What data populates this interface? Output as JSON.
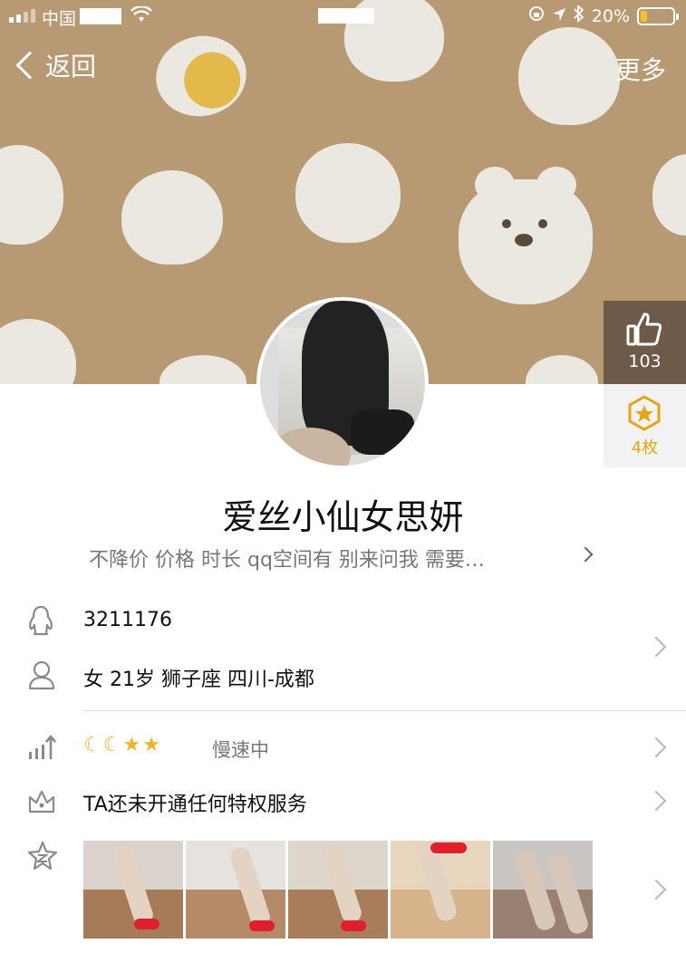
{
  "status_bar": {
    "carrier": "中国",
    "battery_percent": "20%",
    "battery_level": 0.2,
    "battery_color": "#f2c12e"
  },
  "nav": {
    "back_label": "返回",
    "more_label": "更多"
  },
  "likes": {
    "count": "103",
    "icon": "thumbs-up-icon"
  },
  "medals": {
    "count": "4枚",
    "icon": "star-medal-icon",
    "color": "#e6a517"
  },
  "profile": {
    "nickname": "爱丝小仙女思妍",
    "signature": "不降价 价格 时长 qq空间有 别来问我 需要…",
    "qq_number": "3211176",
    "details": "女 21岁 狮子座 四川-成都",
    "level_icons": [
      "moon-icon",
      "moon-icon",
      "star-icon",
      "star-icon"
    ],
    "level_status": "慢速中",
    "privilege_text": "TA还未开通任何特权服务",
    "photos_count": 5
  },
  "colors": {
    "banner": "#b79974",
    "like_bg": "#6e5a48",
    "accent_gold": "#f0b429"
  }
}
